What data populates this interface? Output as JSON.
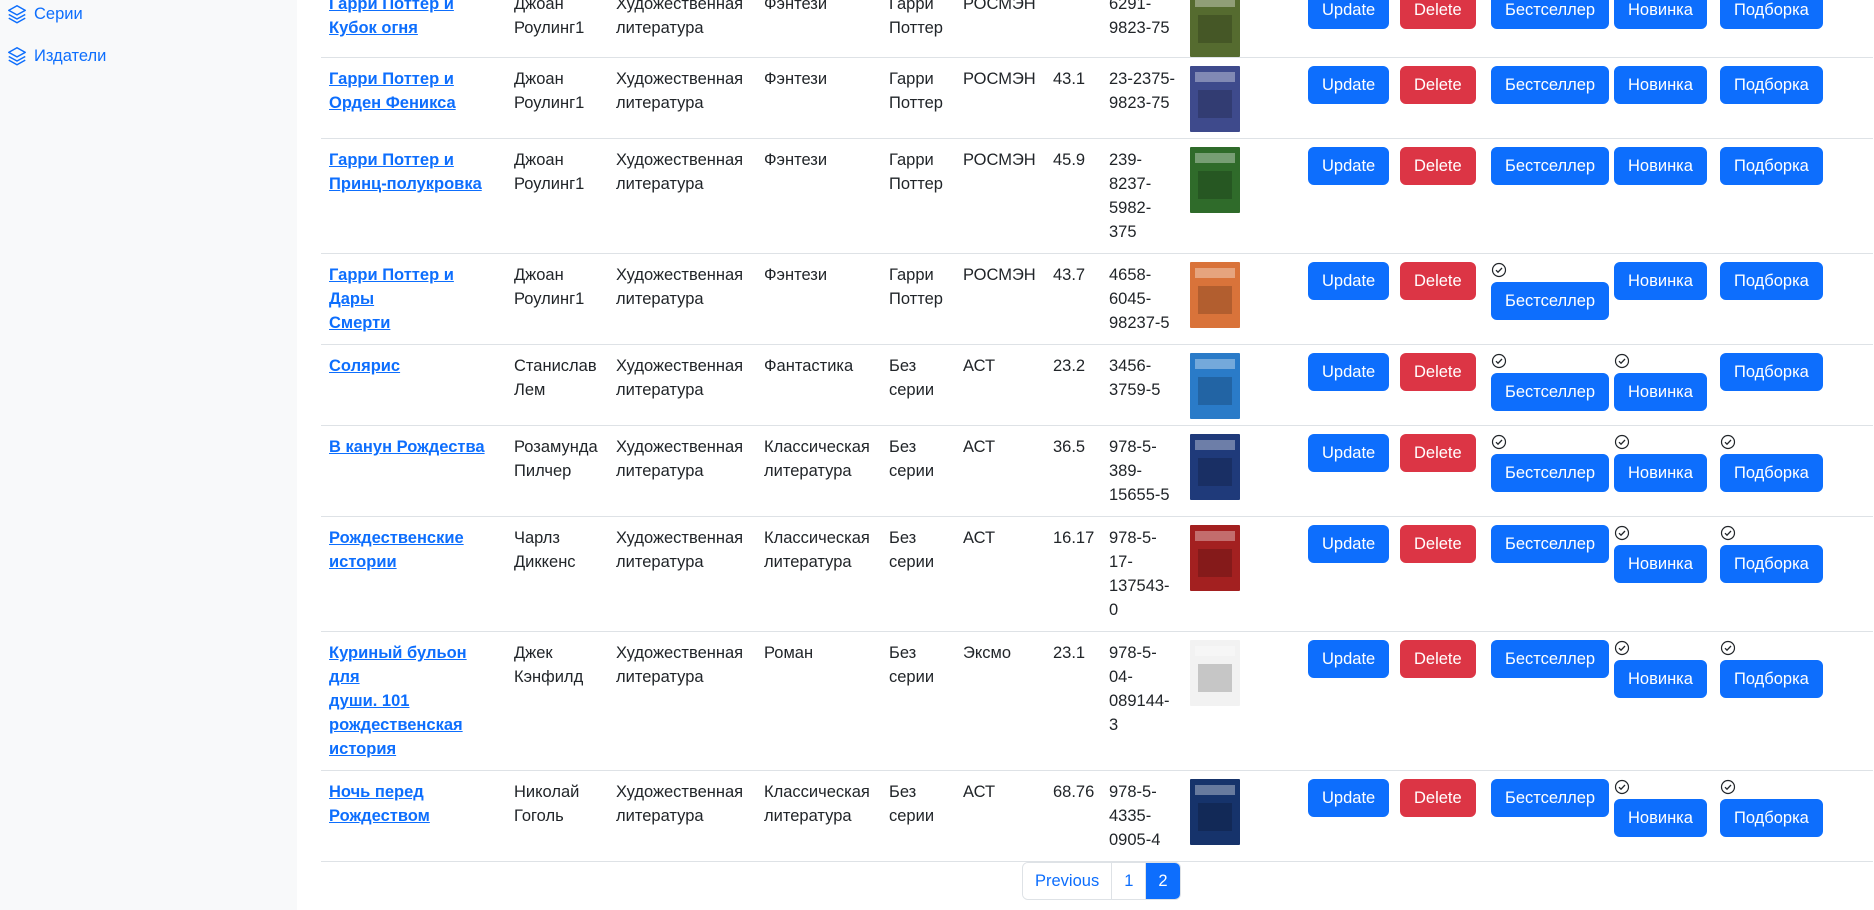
{
  "sidebar": {
    "items": [
      {
        "label": "Серии",
        "icon": "layers-icon"
      },
      {
        "label": "Издатели",
        "icon": "layers-icon"
      }
    ]
  },
  "actions": {
    "update": "Update",
    "delete": "Delete",
    "bestseller": "Бестселлер",
    "novelty": "Новинка",
    "collection": "Подборка"
  },
  "rows": [
    {
      "title": "Гарри Поттер и Кубок огня",
      "title_line1": "Гарри Поттер и",
      "title_line2": "Кубок огня",
      "author_first": "Джоан",
      "author_last": "Роулинг1",
      "category_1": "Художественная",
      "category_2": "литература",
      "genre_1": "Фэнтези",
      "genre_2": "",
      "series_1": "Гарри",
      "series_2": "Поттер",
      "publisher": "РОСМЭН",
      "price": "",
      "isbn_1": "",
      "isbn_2": "6291-",
      "isbn_3": "9823-75",
      "cover_color": "#556b2f",
      "flags": {
        "bestseller": false,
        "novelty": false,
        "collection": false
      }
    },
    {
      "title": "Гарри Поттер и Орден Феникса",
      "title_line1": "Гарри Поттер и",
      "title_line2": "Орден Феникса",
      "author_first": "Джоан",
      "author_last": "Роулинг1",
      "category_1": "Художественная",
      "category_2": "литература",
      "genre_1": "Фэнтези",
      "genre_2": "",
      "series_1": "Гарри",
      "series_2": "Поттер",
      "publisher": "РОСМЭН",
      "price": "43.1",
      "isbn_1": "23-2375-",
      "isbn_2": "9823-75",
      "isbn_3": "",
      "cover_color": "#3e4a8c",
      "flags": {
        "bestseller": false,
        "novelty": false,
        "collection": false
      }
    },
    {
      "title": "Гарри Поттер и Принц-полукровка",
      "title_line1": "Гарри Поттер и",
      "title_line2": "Принц-полукровка",
      "author_first": "Джоан",
      "author_last": "Роулинг1",
      "category_1": "Художественная",
      "category_2": "литература",
      "genre_1": "Фэнтези",
      "genre_2": "",
      "series_1": "Гарри",
      "series_2": "Поттер",
      "publisher": "РОСМЭН",
      "price": "45.9",
      "isbn_1": "239-",
      "isbn_2": "8237-",
      "isbn_3": "5982-375",
      "cover_color": "#2f6b2a",
      "flags": {
        "bestseller": false,
        "novelty": false,
        "collection": false
      }
    },
    {
      "title": "Гарри Поттер и Дары Смерти",
      "title_line1": "Гарри Поттер и Дары",
      "title_line2": "Смерти",
      "author_first": "Джоан",
      "author_last": "Роулинг1",
      "category_1": "Художественная",
      "category_2": "литература",
      "genre_1": "Фэнтези",
      "genre_2": "",
      "series_1": "Гарри",
      "series_2": "Поттер",
      "publisher": "РОСМЭН",
      "price": "43.7",
      "isbn_1": "4658-",
      "isbn_2": "6045-",
      "isbn_3": "98237-5",
      "cover_color": "#d9733a",
      "flags": {
        "bestseller": true,
        "novelty": false,
        "collection": false
      }
    },
    {
      "title": "Солярис",
      "title_line1": "Солярис",
      "title_line2": "",
      "author_first": "Станислав",
      "author_last": "Лем",
      "category_1": "Художественная",
      "category_2": "литература",
      "genre_1": "Фантастика",
      "genre_2": "",
      "series_1": "Без",
      "series_2": "серии",
      "publisher": "АСТ",
      "price": "23.2",
      "isbn_1": "3456-",
      "isbn_2": "3759-5",
      "isbn_3": "",
      "cover_color": "#2a7bc8",
      "flags": {
        "bestseller": true,
        "novelty": true,
        "collection": false
      }
    },
    {
      "title": "В канун Рождества",
      "title_line1": "В канун Рождества",
      "title_line2": "",
      "author_first": "Розамунда",
      "author_last": "Пилчер",
      "category_1": "Художественная",
      "category_2": "литература",
      "genre_1": "Классическая",
      "genre_2": "литература",
      "series_1": "Без",
      "series_2": "серии",
      "publisher": "АСТ",
      "price": "36.5",
      "isbn_1": "978-5-",
      "isbn_2": "389-",
      "isbn_3": "15655-5",
      "cover_color": "#1f3a7a",
      "flags": {
        "bestseller": true,
        "novelty": true,
        "collection": true
      }
    },
    {
      "title": "Рождественские истории",
      "title_line1": "Рождественские",
      "title_line2": "истории",
      "author_first": "Чарлз",
      "author_last": "Диккенс",
      "category_1": "Художественная",
      "category_2": "литература",
      "genre_1": "Классическая",
      "genre_2": "литература",
      "series_1": "Без",
      "series_2": "серии",
      "publisher": "АСТ",
      "price": "16.17",
      "isbn_1": "978-5-",
      "isbn_2": "17-",
      "isbn_3": "137543-0",
      "cover_color": "#a32020",
      "flags": {
        "bestseller": false,
        "novelty": true,
        "collection": true
      }
    },
    {
      "title": "Куриный бульон для души. 101 рождественская история",
      "title_line1": "Куриный бульон для",
      "title_line2": "души. 101",
      "title_line3": "рождественская",
      "title_line4": "история",
      "author_first": "Джек",
      "author_last": "Кэнфилд",
      "category_1": "Художественная",
      "category_2": "литература",
      "genre_1": "Роман",
      "genre_2": "",
      "series_1": "Без",
      "series_2": "серии",
      "publisher": "Эксмо",
      "price": "23.1",
      "isbn_1": "978-5-",
      "isbn_2": "04-",
      "isbn_3": "089144-3",
      "cover_color": "#f2f2f2",
      "flags": {
        "bestseller": false,
        "novelty": true,
        "collection": true
      }
    },
    {
      "title": "Ночь перед Рождеством",
      "title_line1": "Ночь перед",
      "title_line2": "Рождеством",
      "author_first": "Николай",
      "author_last": "Гоголь",
      "category_1": "Художественная",
      "category_2": "литература",
      "genre_1": "Классическая",
      "genre_2": "литература",
      "series_1": "Без",
      "series_2": "серии",
      "publisher": "АСТ",
      "price": "68.76",
      "isbn_1": "978-5-",
      "isbn_2": "4335-",
      "isbn_3": "0905-4",
      "cover_color": "#16336b",
      "flags": {
        "bestseller": false,
        "novelty": true,
        "collection": true
      }
    }
  ],
  "pagination": {
    "previous": "Previous",
    "pages": [
      "1",
      "2"
    ],
    "active": "2"
  }
}
